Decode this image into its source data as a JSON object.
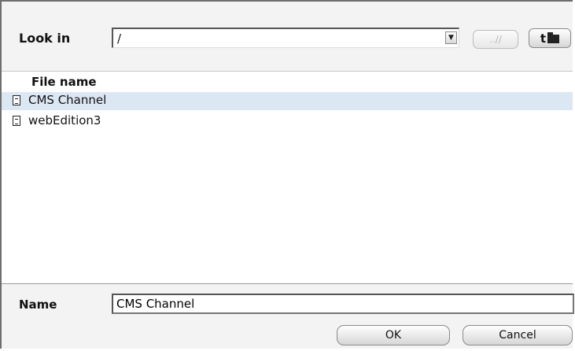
{
  "lookin": {
    "label": "Look in",
    "value": "/"
  },
  "toolbar": {
    "up_label": "..//",
    "newdir_label": "t"
  },
  "filelist": {
    "column_header": "File name",
    "items": [
      {
        "name": "CMS Channel",
        "selected": true
      },
      {
        "name": "webEdition3",
        "selected": false
      }
    ]
  },
  "bottom": {
    "name_label": "Name",
    "name_value": "CMS Channel",
    "ok_label": "OK",
    "cancel_label": "Cancel"
  },
  "colors": {
    "selection": "#dce7f4",
    "panel": "#f3f3f3"
  }
}
